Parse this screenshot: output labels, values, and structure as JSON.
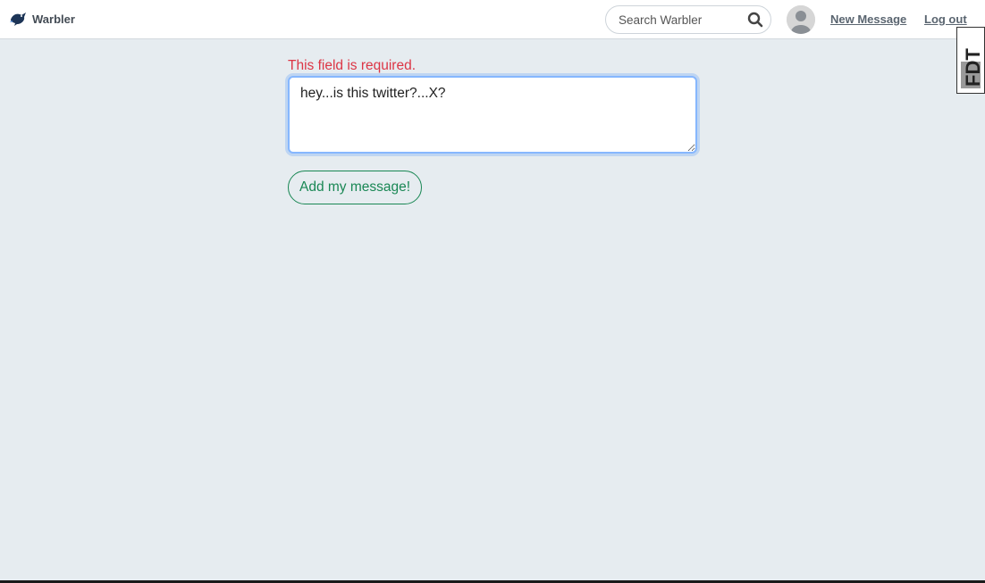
{
  "navbar": {
    "brand_text": "Warbler",
    "search_placeholder": "Search Warbler",
    "new_message_label": "New Message",
    "logout_label": "Log out"
  },
  "debug_tab": {
    "label": "FDT"
  },
  "form": {
    "error_text": "This field is required.",
    "message_value": "hey...is this twitter?...X?",
    "submit_label": "Add my message!"
  },
  "colors": {
    "error": "#dc3545",
    "success": "#198754",
    "page_background": "#e6ecf0",
    "focus_border": "#86b7fe"
  }
}
